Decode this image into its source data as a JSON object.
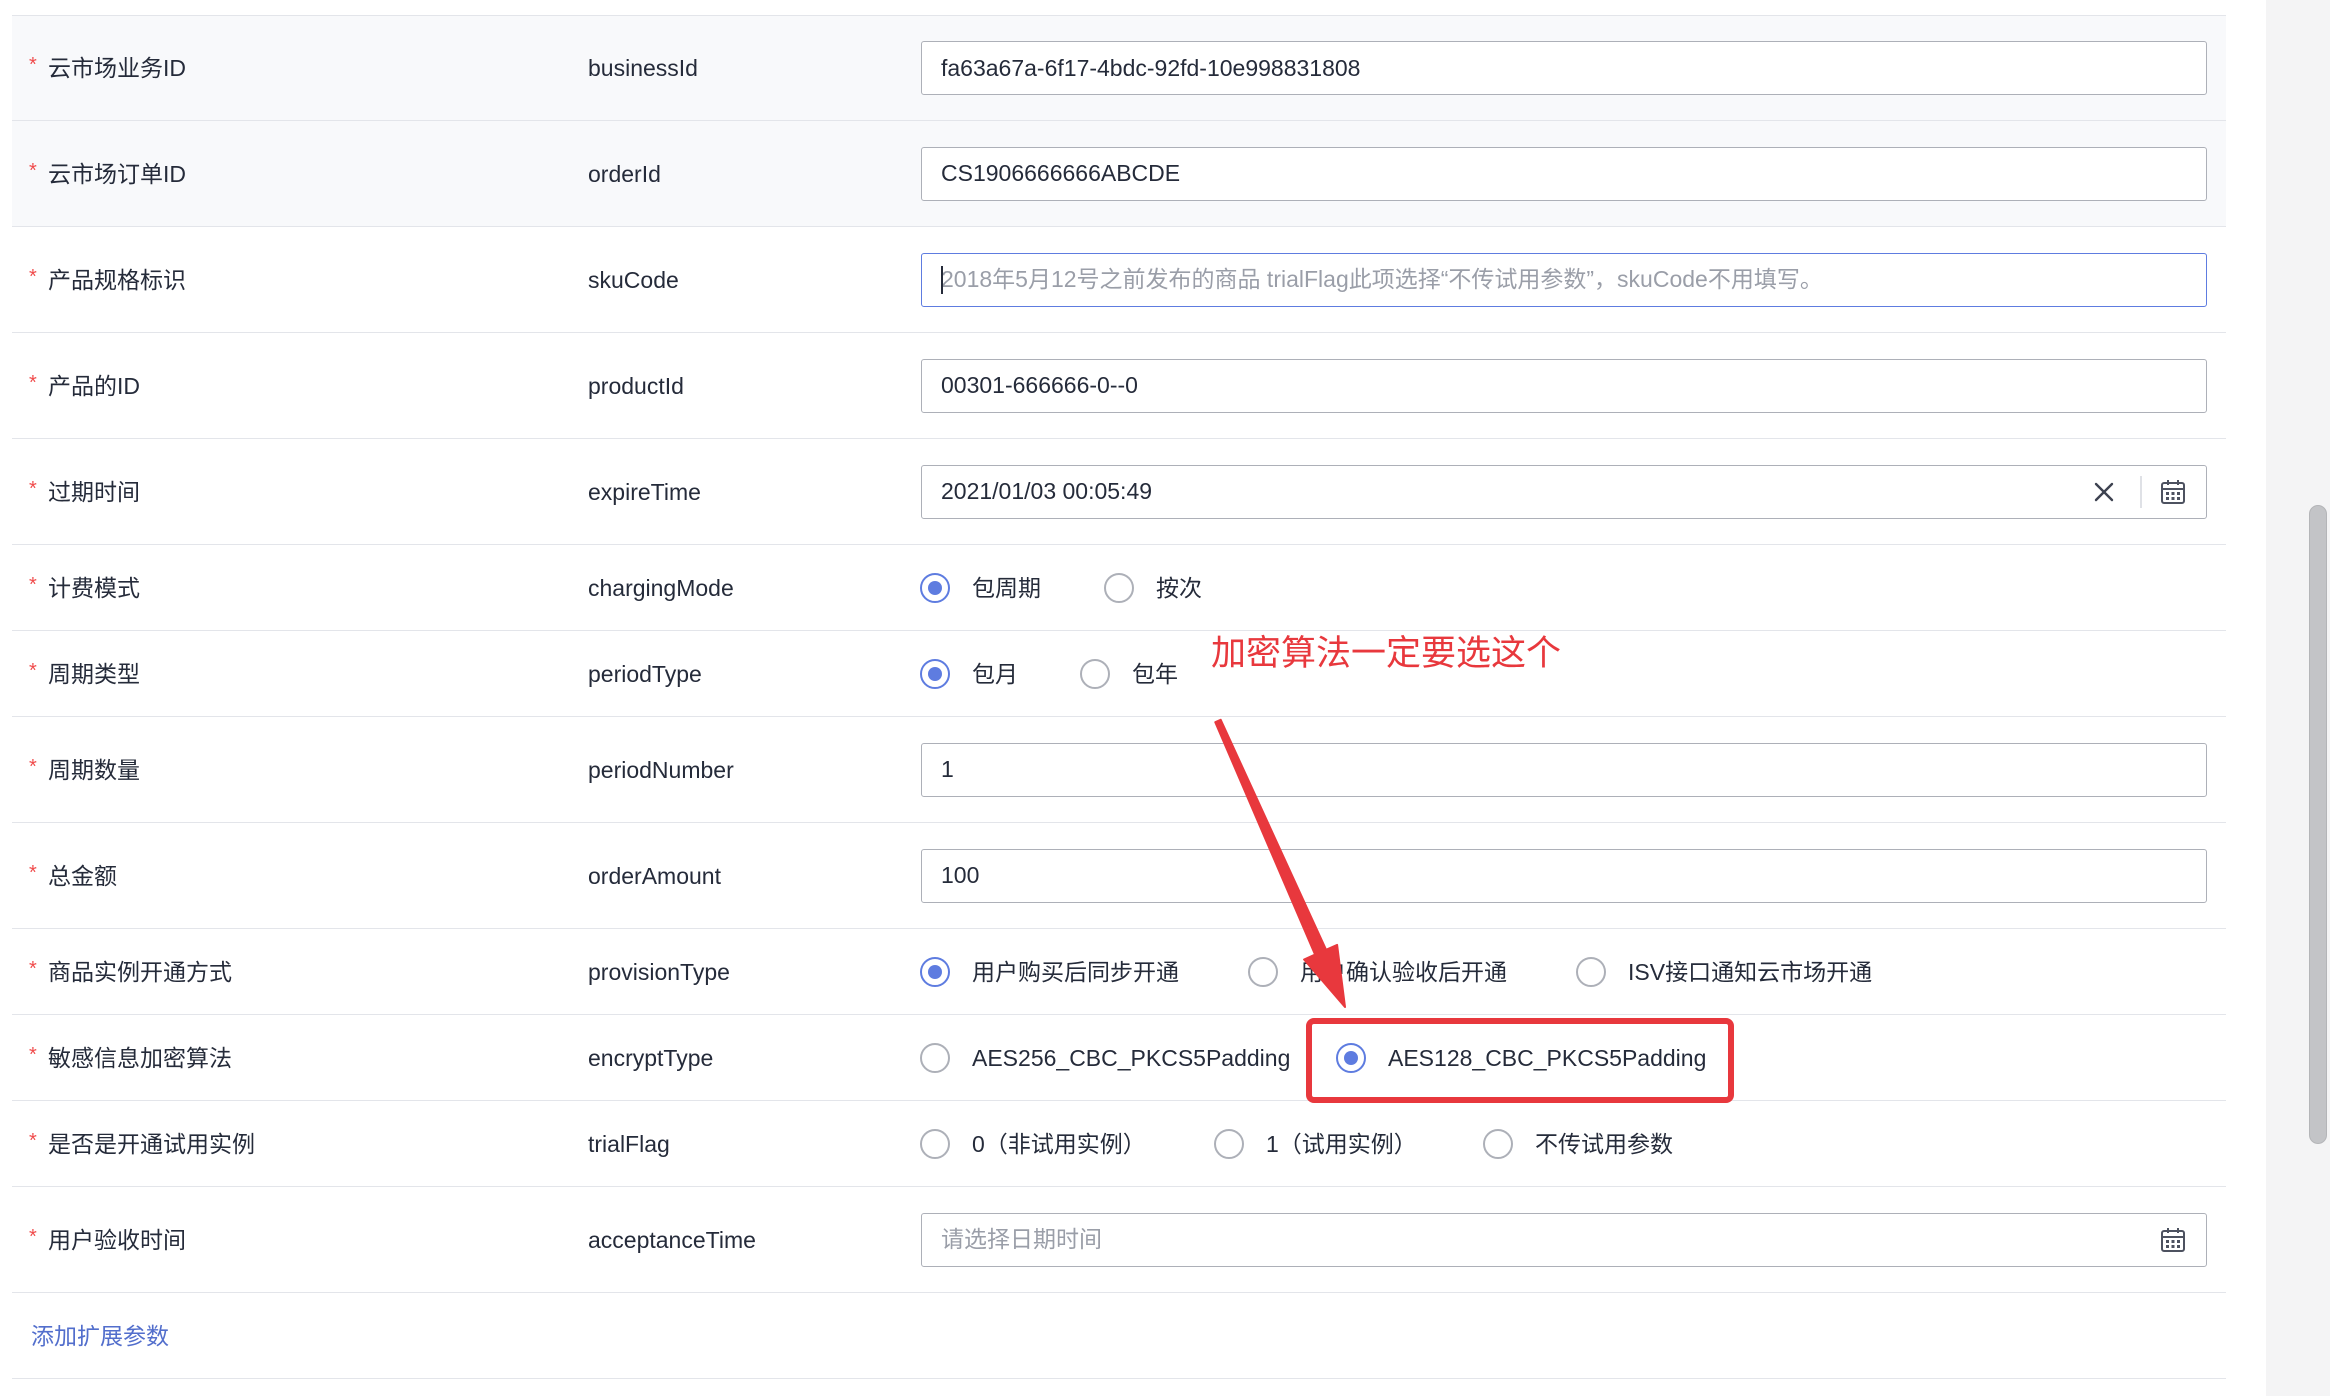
{
  "required_mark": "*",
  "fields": [
    {
      "label": "云市场业务ID",
      "param": "businessId",
      "value": "fa63a67a-6f17-4bdc-92fd-10e998831808"
    },
    {
      "label": "云市场订单ID",
      "param": "orderId",
      "value": "CS1906666666ABCDE"
    },
    {
      "label": "产品规格标识",
      "param": "skuCode",
      "value": "",
      "placeholder": "2018年5月12号之前发布的商品 trialFlag此项选择“不传试用参数”，skuCode不用填写。",
      "focused": true
    },
    {
      "label": "产品的ID",
      "param": "productId",
      "value": "00301-666666-0--0"
    },
    {
      "label": "过期时间",
      "param": "expireTime",
      "value": "2021/01/03 00:05:49",
      "clear_icon": "close-icon",
      "picker_icon": "calendar-icon"
    },
    {
      "label": "计费模式",
      "param": "chargingMode",
      "options": [
        {
          "label": "包周期",
          "checked": true
        },
        {
          "label": "按次",
          "checked": false
        }
      ]
    },
    {
      "label": "周期类型",
      "param": "periodType",
      "options": [
        {
          "label": "包月",
          "checked": true
        },
        {
          "label": "包年",
          "checked": false
        }
      ]
    },
    {
      "label": "周期数量",
      "param": "periodNumber",
      "value": "1"
    },
    {
      "label": "总金额",
      "param": "orderAmount",
      "value": "100"
    },
    {
      "label": "商品实例开通方式",
      "param": "provisionType",
      "options": [
        {
          "label": "用户购买后同步开通",
          "checked": true
        },
        {
          "label": "用户确认验收后开通",
          "checked": false
        },
        {
          "label": "ISV接口通知云市场开通",
          "checked": false
        }
      ]
    },
    {
      "label": "敏感信息加密算法",
      "param": "encryptType",
      "options": [
        {
          "label": "AES256_CBC_PKCS5Padding",
          "checked": false
        },
        {
          "label": "AES128_CBC_PKCS5Padding",
          "checked": true
        }
      ]
    },
    {
      "label": "是否是开通试用实例",
      "param": "trialFlag",
      "options": [
        {
          "label": "0（非试用实例）",
          "checked": false
        },
        {
          "label": "1（试用实例）",
          "checked": false
        },
        {
          "label": "不传试用参数",
          "checked": false
        }
      ]
    },
    {
      "label": "用户验收时间",
      "param": "acceptanceTime",
      "value": "",
      "placeholder": "请选择日期时间",
      "picker_icon": "calendar-icon"
    }
  ],
  "add_link": "添加扩展参数",
  "annotation": {
    "text": "加密算法一定要选这个"
  },
  "theme": {
    "accent": "#5e7ce0",
    "required": "#f04b4b",
    "annotation": "#e8383d",
    "input_border": "#adb0b8",
    "link": "#526ecc"
  }
}
